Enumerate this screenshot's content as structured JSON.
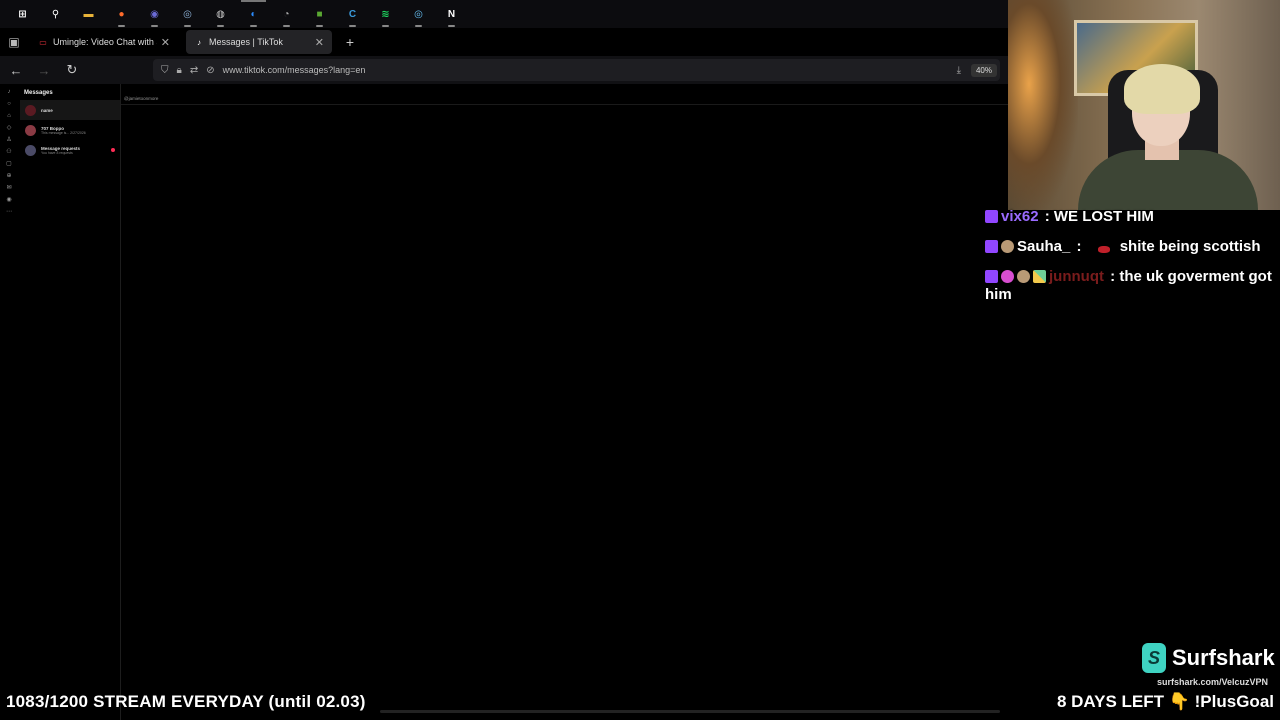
{
  "taskbar": {
    "icons": [
      {
        "name": "windows-start-icon",
        "glyph": "⊞",
        "color": "#ffffff",
        "active": false
      },
      {
        "name": "search-icon",
        "glyph": "⚲",
        "color": "#ffffff",
        "active": false
      },
      {
        "name": "file-explorer-icon",
        "glyph": "▬",
        "color": "#e8b339",
        "active": false
      },
      {
        "name": "firefox-icon",
        "glyph": "●",
        "color": "#ff6b2b",
        "active": false
      },
      {
        "name": "chrome-icon",
        "glyph": "◉",
        "color": "#6b6bd6",
        "active": false
      },
      {
        "name": "steam-icon",
        "glyph": "◎",
        "color": "#8fb3d9",
        "active": false
      },
      {
        "name": "obs-icon",
        "glyph": "◍",
        "color": "#cccccc",
        "active": false
      },
      {
        "name": "browser-icon",
        "glyph": "◐",
        "color": "#2b8cff",
        "active": true
      },
      {
        "name": "speedtest-icon",
        "glyph": "◔",
        "color": "#aaaaaa",
        "active": false
      },
      {
        "name": "minecraft-icon",
        "glyph": "■",
        "color": "#5aa832",
        "active": false
      },
      {
        "name": "ccleaner-icon",
        "glyph": "C",
        "color": "#3a9bdc",
        "active": false
      },
      {
        "name": "spotify-icon",
        "glyph": "≋",
        "color": "#1ed760",
        "active": false
      },
      {
        "name": "steam-alt-icon",
        "glyph": "◎",
        "color": "#66c0f4",
        "active": false
      },
      {
        "name": "notion-icon",
        "glyph": "N",
        "color": "#ffffff",
        "active": false
      }
    ]
  },
  "tabs": [
    {
      "title": "Umingle: Video Chat with Strang",
      "favicon_color": "#e0303a"
    },
    {
      "title": "Messages | TikTok",
      "favicon_color": "#ffffff"
    }
  ],
  "navbar": {
    "url": "www.tiktok.com/messages?lang=en",
    "zoom": "40%"
  },
  "tiktok": {
    "heading": "Messages",
    "conversations": [
      {
        "name": "name",
        "preview": "",
        "avatar_color": "#5a1a22",
        "selected": true,
        "unread": false
      },
      {
        "name": "707 Boppo",
        "preview": "This message is...   2/27/2026",
        "avatar_color": "#8a3a44",
        "selected": false,
        "unread": false
      },
      {
        "name": "Message requests",
        "preview": "You have 8 requests",
        "avatar_color": "#4a4a66",
        "selected": false,
        "unread": true
      }
    ],
    "convo_user": "@jamietoonmore"
  },
  "chat": [
    {
      "badges": [
        "twitch"
      ],
      "user": "vix62",
      "user_color": "#9a6bff",
      "text": "WE LOST HIM",
      "emote": false
    },
    {
      "badges": [
        "twitch",
        "face"
      ],
      "user": "Sauha_",
      "user_color": "#ffffff",
      "text": "shite being scottish",
      "emote": true
    },
    {
      "badges": [
        "twitch",
        "heart",
        "face",
        "pencil"
      ],
      "user": "junnuqt",
      "user_color": "#7a1c1c",
      "text": "the uk goverment got him",
      "emote": false
    }
  ],
  "sponsor": {
    "brand": "Surfshark",
    "site": "surfshark.com/VelcuzVPN"
  },
  "ticker": {
    "left": "1083/1200 STREAM EVERYDAY (until 02.03)",
    "right": "8 DAYS LEFT 👇 !PlusGoal"
  }
}
